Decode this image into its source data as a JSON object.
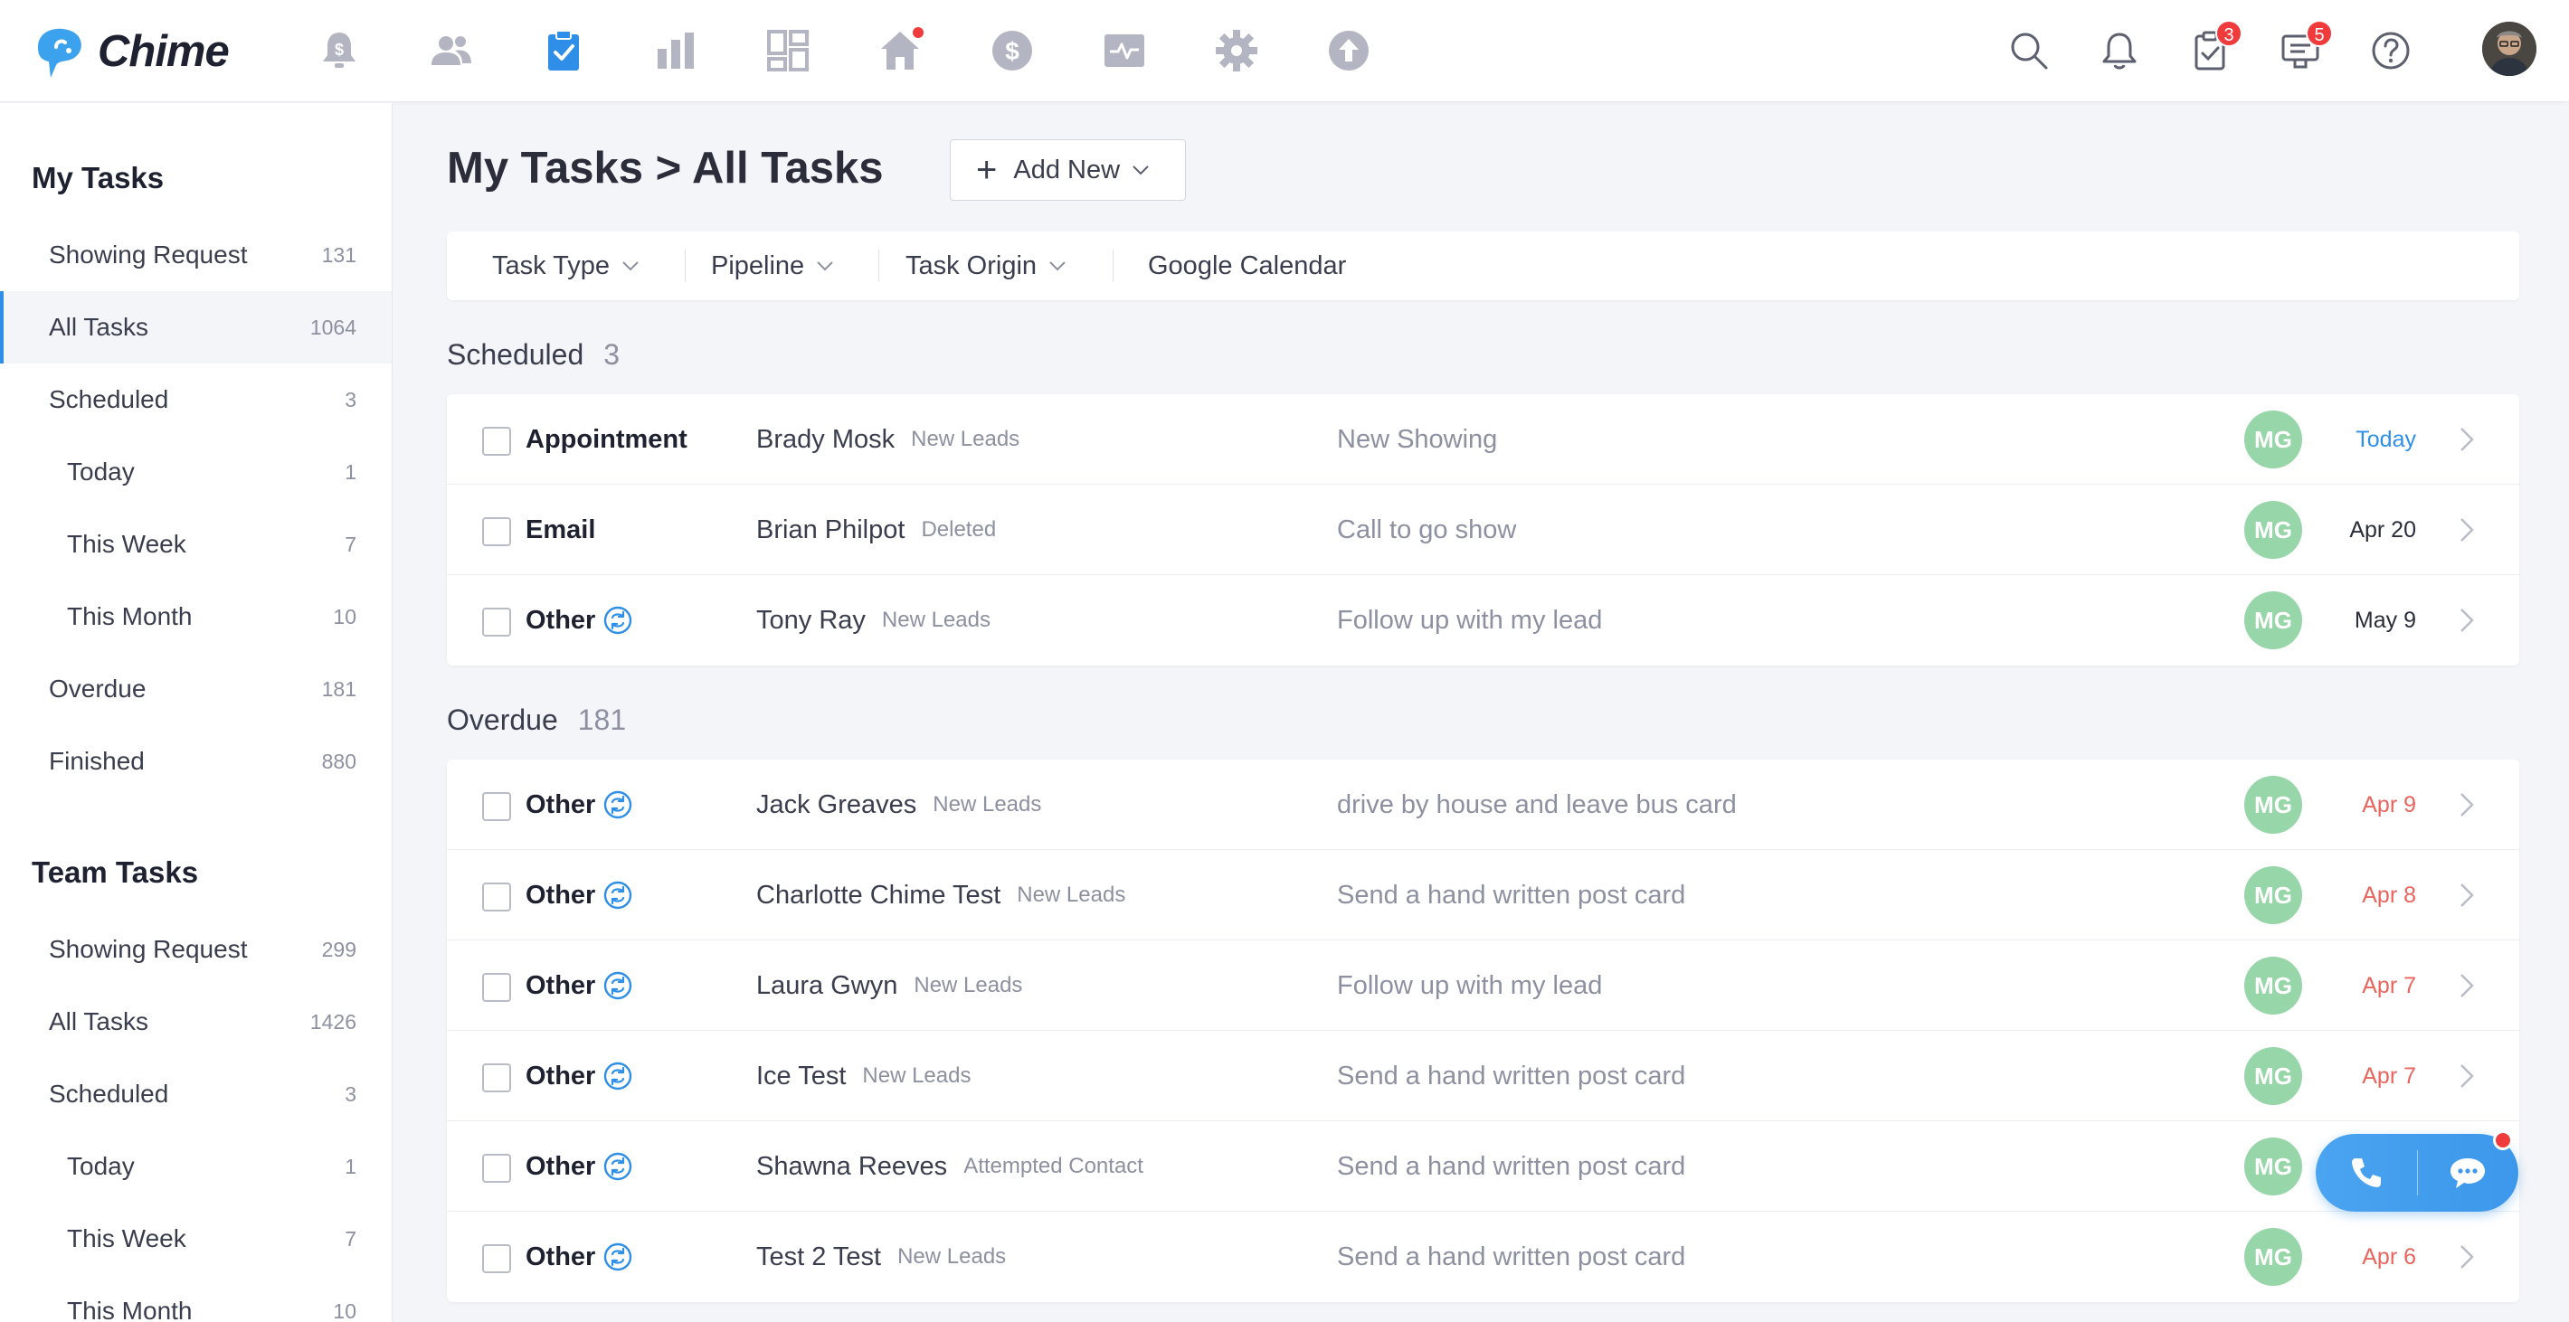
{
  "app": {
    "name": "Chime"
  },
  "topnav": {
    "icons": [
      "alert-dollar-icon",
      "people-icon",
      "clipboard-check-icon",
      "bar-chart-icon",
      "dashboard-icon",
      "home-icon",
      "dollar-circle-icon",
      "activity-icon",
      "gear-icon",
      "upload-icon"
    ],
    "active": "clipboard-check-icon",
    "right": {
      "tasks_badge": "3",
      "messages_badge": "5"
    }
  },
  "sidebar": {
    "my_tasks": {
      "title": "My Tasks",
      "items": [
        {
          "label": "Showing Request",
          "count": "131"
        },
        {
          "label": "All Tasks",
          "count": "1064"
        },
        {
          "label": "Scheduled",
          "count": "3"
        },
        {
          "label": "Today",
          "count": "1"
        },
        {
          "label": "This Week",
          "count": "7"
        },
        {
          "label": "This Month",
          "count": "10"
        },
        {
          "label": "Overdue",
          "count": "181"
        },
        {
          "label": "Finished",
          "count": "880"
        }
      ]
    },
    "team_tasks": {
      "title": "Team Tasks",
      "items": [
        {
          "label": "Showing Request",
          "count": "299"
        },
        {
          "label": "All Tasks",
          "count": "1426"
        },
        {
          "label": "Scheduled",
          "count": "3"
        },
        {
          "label": "Today",
          "count": "1"
        },
        {
          "label": "This Week",
          "count": "7"
        },
        {
          "label": "This Month",
          "count": "10"
        }
      ]
    }
  },
  "main": {
    "title": "My Tasks > All Tasks",
    "add_new_label": "Add New",
    "filters": [
      "Task Type",
      "Pipeline",
      "Task Origin",
      "Google Calendar"
    ],
    "sections": [
      {
        "title": "Scheduled",
        "count": "3",
        "rows": [
          {
            "type": "Appointment",
            "repeat": false,
            "lead": "Brady Mosk",
            "pipeline": "New Leads",
            "desc": "New Showing",
            "assignee": "MG",
            "date": "Today",
            "date_style": "today"
          },
          {
            "type": "Email",
            "repeat": false,
            "lead": "Brian Philpot",
            "pipeline": "Deleted",
            "desc": "Call to go show",
            "assignee": "MG",
            "date": "Apr 20",
            "date_style": "normal"
          },
          {
            "type": "Other",
            "repeat": true,
            "lead": "Tony Ray",
            "pipeline": "New Leads",
            "desc": "Follow up with my lead",
            "assignee": "MG",
            "date": "May 9",
            "date_style": "normal"
          }
        ]
      },
      {
        "title": "Overdue",
        "count": "181",
        "rows": [
          {
            "type": "Other",
            "repeat": true,
            "lead": "Jack Greaves",
            "pipeline": "New Leads",
            "desc": "drive by house and leave bus card",
            "assignee": "MG",
            "date": "Apr 9",
            "date_style": "overdue"
          },
          {
            "type": "Other",
            "repeat": true,
            "lead": "Charlotte Chime Test",
            "pipeline": "New Leads",
            "desc": "Send a hand written post card",
            "assignee": "MG",
            "date": "Apr 8",
            "date_style": "overdue"
          },
          {
            "type": "Other",
            "repeat": true,
            "lead": "Laura Gwyn",
            "pipeline": "New Leads",
            "desc": "Follow up with my lead",
            "assignee": "MG",
            "date": "Apr 7",
            "date_style": "overdue"
          },
          {
            "type": "Other",
            "repeat": true,
            "lead": "Ice Test",
            "pipeline": "New Leads",
            "desc": "Send a hand written post card",
            "assignee": "MG",
            "date": "Apr 7",
            "date_style": "overdue"
          },
          {
            "type": "Other",
            "repeat": true,
            "lead": "Shawna Reeves",
            "pipeline": "Attempted Contact",
            "desc": "Send a hand written post card",
            "assignee": "MG",
            "date": "",
            "date_style": "overdue"
          },
          {
            "type": "Other",
            "repeat": true,
            "lead": "Test 2 Test",
            "pipeline": "New Leads",
            "desc": "Send a hand written post card",
            "assignee": "MG",
            "date": "Apr 6",
            "date_style": "overdue"
          }
        ]
      }
    ]
  },
  "colors": {
    "accent": "#2f8fe8",
    "overdue": "#e8645e",
    "assignee": "#97d6a8",
    "badge": "#ef3b3b"
  },
  "floating_widget": {
    "icons": [
      "phone-icon",
      "chat-icon"
    ]
  }
}
